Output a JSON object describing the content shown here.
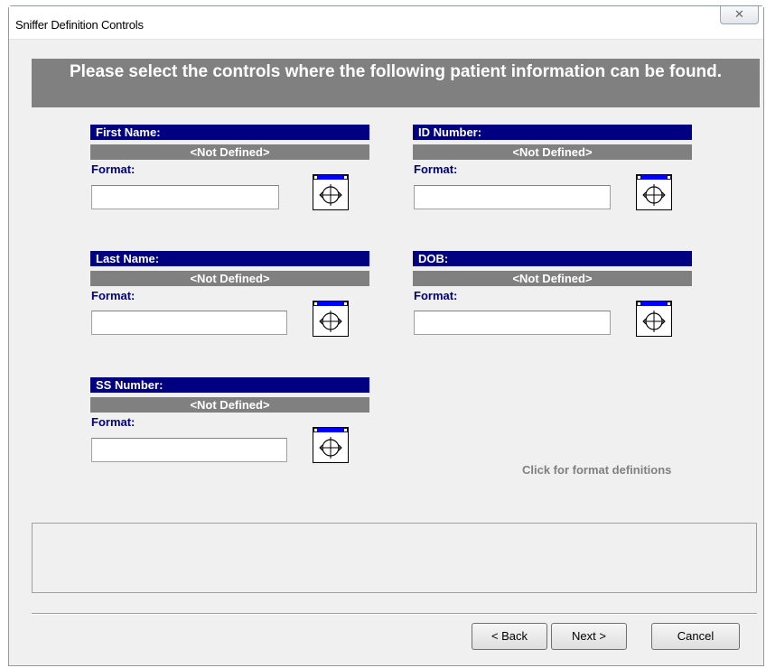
{
  "window": {
    "title": "Sniffer Definition Controls",
    "close_label": "✕"
  },
  "banner": {
    "text": "Please select the controls where the following patient information can be found."
  },
  "fields": {
    "first_name": {
      "label": "First Name:",
      "value": "<Not Defined>",
      "format_label": "Format:",
      "format_value": ""
    },
    "last_name": {
      "label": "Last Name:",
      "value": "<Not Defined>",
      "format_label": "Format:",
      "format_value": ""
    },
    "ss_number": {
      "label": "SS Number:",
      "value": "<Not Defined>",
      "format_label": "Format:",
      "format_value": ""
    },
    "id_number": {
      "label": "ID Number:",
      "value": "<Not Defined>",
      "format_label": "Format:",
      "format_value": ""
    },
    "dob": {
      "label": "DOB:",
      "value": "<Not Defined>",
      "format_label": "Format:",
      "format_value": ""
    }
  },
  "hint": "Click for format definitions",
  "status": {
    "text": ""
  },
  "buttons": {
    "back": "< Back",
    "next": "Next >",
    "cancel": "Cancel"
  },
  "icons": {
    "target": "crosshair-target-icon",
    "close": "close-icon"
  },
  "colors": {
    "header_bg": "#000080",
    "value_bg": "#808080",
    "banner_bg": "#808080",
    "format_label": "#000080"
  }
}
